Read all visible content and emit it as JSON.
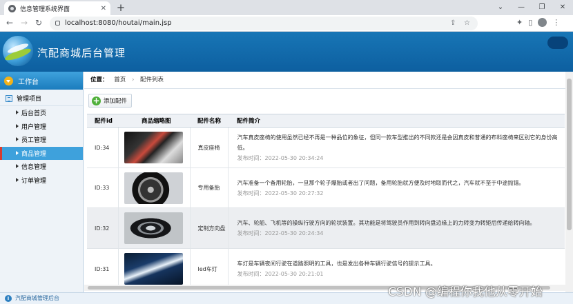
{
  "browser": {
    "tab_title": "信息管理系统界面",
    "tab_close": "✕",
    "new_tab": "+",
    "url": "localhost:8080/houtai/main.jsp",
    "window_controls": [
      "⌄",
      "—",
      "❐",
      "✕"
    ]
  },
  "header": {
    "system_title": "汽配商城后台管理"
  },
  "sidebar": {
    "workbench": "工作台",
    "section": "管理项目",
    "items": [
      {
        "label": "后台首页",
        "active": false
      },
      {
        "label": "用户管理",
        "active": false
      },
      {
        "label": "员工管理",
        "active": false
      },
      {
        "label": "商品管理",
        "active": true
      },
      {
        "label": "信息管理",
        "active": false
      },
      {
        "label": "订单管理",
        "active": false
      }
    ]
  },
  "breadcrumb": {
    "prefix": "位置：",
    "home": "首页",
    "current": "配件列表",
    "separator": "›"
  },
  "toolbar": {
    "add_label": "添加配件"
  },
  "table": {
    "headers": [
      "配件id",
      "商品缩略图",
      "配件名称",
      "配件简介"
    ],
    "rows": [
      {
        "id": "ID:34",
        "name": "真皮座椅",
        "desc": "汽车真皮座椅的使用虽然已经不再是一种品位的象征，但同一款车型推出的不同款还是会因真皮和普通的布料座椅来区别它的身份高低。",
        "time": "发布时间：2022-05-30 20:34:24",
        "thumb": "leather-seat"
      },
      {
        "id": "ID:33",
        "name": "专用备胎",
        "desc": "汽车准备一个备用轮胎，一旦那个轮子爆胎或者出了问题，备用轮胎就方便及时地取而代之，汽车就不至于中途抛锚。",
        "time": "发布时间：2022-05-30 20:27:32",
        "thumb": "spare-tire"
      },
      {
        "id": "ID:32",
        "name": "定制方向盘",
        "desc": "汽车、轮船、飞机等的操纵行驶方向的轮状装置。其功能是将驾驶员作用到转向盘边缘上的力转变为转矩后传递给转向轴。",
        "time": "发布时间：2022-05-30 20:24:34",
        "thumb": "steering-wheel"
      },
      {
        "id": "ID:31",
        "name": "led车灯",
        "desc": "车灯是车辆夜间行驶在道路照明的工具，也是发出各种车辆行驶信号的提示工具。",
        "time": "发布时间：2022-05-30 20:21:01",
        "thumb": "led-headlight"
      }
    ]
  },
  "footer": {
    "text": "汽配商城管理后台"
  },
  "watermark": "CSDN @编程你我他从零开始"
}
